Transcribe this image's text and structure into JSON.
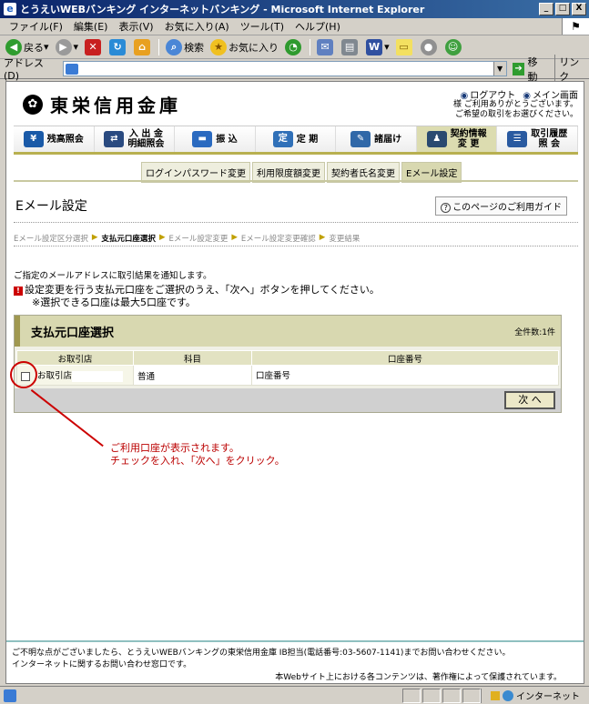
{
  "window": {
    "title": "とうえいWEBバンキング インターネットバンキング - Microsoft Internet Explorer",
    "minimize": "_",
    "maximize": "□",
    "close": "X"
  },
  "menu": [
    "ファイル(F)",
    "編集(E)",
    "表示(V)",
    "お気に入り(A)",
    "ツール(T)",
    "ヘルプ(H)"
  ],
  "toolbar": {
    "back": "戻る",
    "search": "検索",
    "favorites": "お気に入り"
  },
  "address": {
    "label": "アドレス(D)",
    "value": "",
    "go": "移動",
    "links": "リンク"
  },
  "header": {
    "bank_name": "東栄信用金庫",
    "logout": "ログアウト",
    "main_menu": "メイン画面",
    "message_line1": "様 ご利用ありがとうございます。",
    "message_line2": "ご希望の取引をお選びください。"
  },
  "gnav": [
    {
      "label": "残高照会",
      "icon": "yen-icon",
      "color": "#1a5aa8"
    },
    {
      "label": "入 出 金\n明細照会",
      "icon": "transfer-arrows-icon",
      "color": "#2a4a80"
    },
    {
      "label": "振 込",
      "icon": "money-icon",
      "color": "#2a6ac0"
    },
    {
      "label": "定 期",
      "icon": "deposit-icon",
      "color": "#3070b8"
    },
    {
      "label": "諸届け",
      "icon": "pen-icon",
      "color": "#3068a8"
    },
    {
      "label": "契約情報\n変 更",
      "icon": "user-icon",
      "color": "#2a4a70"
    },
    {
      "label": "取引履歴\n照 会",
      "icon": "list-icon",
      "color": "#2a5aa0"
    }
  ],
  "subnav": [
    {
      "label": "ログインパスワード変更",
      "active": false
    },
    {
      "label": "利用限度額変更",
      "active": false
    },
    {
      "label": "契約者氏名変更",
      "active": false
    },
    {
      "label": "Eメール設定",
      "active": true
    }
  ],
  "page": {
    "title": "Eメール設定",
    "guide": "このページのご利用ガイド",
    "steps": [
      {
        "label": "Eメール設定区分選択",
        "active": false
      },
      {
        "label": "支払元口座選択",
        "active": true
      },
      {
        "label": "Eメール設定変更",
        "active": false
      },
      {
        "label": "Eメール設定変更確認",
        "active": false
      },
      {
        "label": "変更結果",
        "active": false
      }
    ],
    "notice": "ご指定のメールアドレスに取引結果を通知します。",
    "instruction1": "設定変更を行う支払元口座をご選択のうえ、「次へ」ボタンを押してください。",
    "instruction2": "※選択できる口座は最大5口座です。"
  },
  "panel": {
    "title": "支払元口座選択",
    "count": "全件数:1件",
    "columns": [
      "お取引店",
      "科目",
      "口座番号"
    ],
    "rows": [
      {
        "branch": "お取引店",
        "type": "普通",
        "number": "口座番号"
      }
    ],
    "next_button": "次 へ"
  },
  "callout": {
    "line1": "ご利用口座が表示されます。",
    "line2": "チェックを入れ、「次へ」をクリック。"
  },
  "footer": {
    "line1": "ご不明な点がございましたら、とうえいWEBバンキングの東栄信用金庫 IB担当(電話番号:03-5607-1141)までお問い合わせください。",
    "line2": "インターネットに関するお問い合わせ窓口です。",
    "copyright": "本Webサイト上における各コンテンツは、著作権によって保護されています。"
  },
  "status": {
    "zone": "インターネット"
  }
}
